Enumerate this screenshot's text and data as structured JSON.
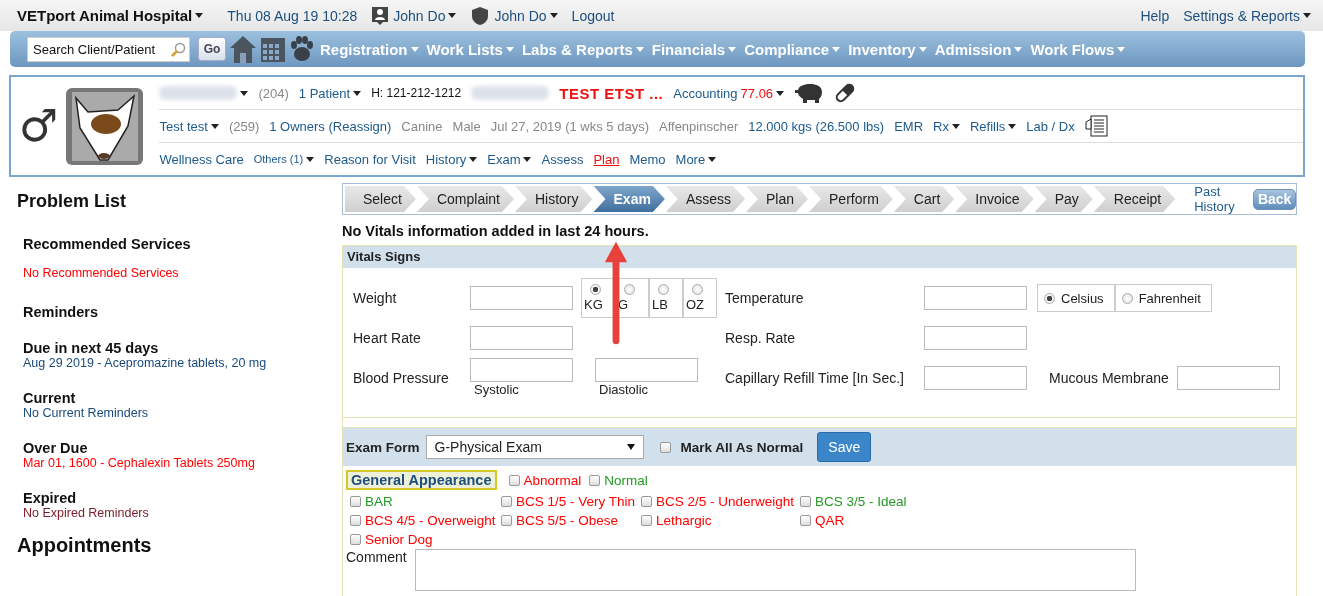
{
  "top_bar": {
    "hospital": "VETport Animal Hospital",
    "datetime": "Thu 08 Aug 19 10:28",
    "users": [
      {
        "kind": "person",
        "name": "John Do"
      },
      {
        "kind": "badge",
        "name": "John Do"
      }
    ],
    "logout": "Logout",
    "help": "Help",
    "settings": "Settings & Reports"
  },
  "nav": {
    "search_placeholder": "Search Client/Patient",
    "go": "Go",
    "menus": [
      "Registration",
      "Work Lists",
      "Labs & Reports",
      "Financials",
      "Compliance",
      "Inventory",
      "Admission",
      "Work Flows"
    ]
  },
  "patient": {
    "gender_symbol": "♂",
    "row1": [
      {
        "kind": "blurred",
        "dropdown": true
      },
      {
        "kind": "muted",
        "text": "(204)"
      },
      {
        "kind": "link",
        "text": "1  Patient",
        "dropdown": true
      },
      {
        "kind": "plain",
        "text": "H: 121-212-1212"
      },
      {
        "kind": "blurred"
      },
      {
        "kind": "alert",
        "text": "TEST ETST ..."
      },
      {
        "kind": "link",
        "text": "Accounting"
      },
      {
        "kind": "amount",
        "text": "77.06",
        "dropdown": true
      },
      {
        "kind": "piggy"
      },
      {
        "kind": "pill"
      }
    ],
    "row2": [
      {
        "kind": "link",
        "text": "Test test",
        "dropdown": true
      },
      {
        "kind": "muted",
        "text": "(259)"
      },
      {
        "kind": "link",
        "text": "1 Owners (Reassign)"
      },
      {
        "kind": "muted",
        "text": "Canine"
      },
      {
        "kind": "muted",
        "text": "Male"
      },
      {
        "kind": "muted",
        "text": "Jul 27, 2019 (1 wks 5 days)"
      },
      {
        "kind": "muted",
        "text": "Affenpinscher"
      },
      {
        "kind": "link",
        "text": "12.000 kgs (26.500 lbs)"
      },
      {
        "kind": "link",
        "text": "EMR"
      },
      {
        "kind": "link",
        "text": "Rx",
        "dropdown": true
      },
      {
        "kind": "link",
        "text": "Refills",
        "dropdown": true
      },
      {
        "kind": "link",
        "text": "Lab / Dx"
      },
      {
        "kind": "document"
      }
    ],
    "row3": [
      {
        "kind": "link",
        "text": "Wellness Care"
      },
      {
        "kind": "small",
        "text": "Others (1)",
        "dropdown": true
      },
      {
        "kind": "link",
        "text": "Reason for Visit"
      },
      {
        "kind": "link",
        "text": "History",
        "dropdown": true
      },
      {
        "kind": "link",
        "text": "Exam",
        "dropdown": true
      },
      {
        "kind": "link",
        "text": "Assess"
      },
      {
        "kind": "alert_link",
        "text": "Plan"
      },
      {
        "kind": "link",
        "text": "Memo"
      },
      {
        "kind": "link",
        "text": "More",
        "dropdown": true
      }
    ]
  },
  "sidebar": {
    "title": "Problem List",
    "sections": [
      {
        "heading": "Recommended Services",
        "kind": "spaced",
        "items": [
          {
            "text": "No Recommended Services",
            "color": "#ff0000"
          }
        ]
      },
      {
        "heading": "Reminders",
        "kind": "spaced"
      },
      {
        "heading": "Due in next 45 days",
        "kind": "tight",
        "items": [
          {
            "text": "Aug 29 2019 - Acepromazine tablets, 20 mg",
            "color": "#1a4a7a"
          }
        ]
      },
      {
        "heading": "Current",
        "kind": "tight",
        "items": [
          {
            "text": "No Current Reminders",
            "color": "#1a4a7a"
          }
        ]
      },
      {
        "heading": "Over Due",
        "kind": "tight",
        "items": [
          {
            "text": "Mar 01, 1600 - Cephalexin Tablets 250mg",
            "color": "#ff0000"
          }
        ]
      },
      {
        "heading": "Expired",
        "kind": "tight",
        "items": [
          {
            "text": "No Expired Reminders",
            "color": "#7a1a2a"
          }
        ]
      }
    ],
    "footer_title": "Appointments"
  },
  "workflow": {
    "steps": [
      {
        "label": "Select",
        "selected": false
      },
      {
        "label": "Complaint",
        "selected": false
      },
      {
        "label": "History",
        "selected": false
      },
      {
        "label": "Exam",
        "selected": true
      },
      {
        "label": "Assess",
        "selected": false
      },
      {
        "label": "Plan",
        "selected": false
      },
      {
        "label": "Perform",
        "selected": false
      },
      {
        "label": "Cart",
        "selected": false
      },
      {
        "label": "Invoice",
        "selected": false
      },
      {
        "label": "Pay",
        "selected": false
      },
      {
        "label": "Receipt",
        "selected": false
      }
    ],
    "past_history": "Past History",
    "back": "Back"
  },
  "notice": "No Vitals information added in last 24 hours.",
  "vitals": {
    "title": "Vitals Signs",
    "weight": {
      "label": "Weight",
      "units": [
        {
          "label": "KG",
          "selected": true
        },
        {
          "label": "G",
          "selected": false
        },
        {
          "label": "LB",
          "selected": false
        },
        {
          "label": "OZ",
          "selected": false
        }
      ]
    },
    "temperature": {
      "label": "Temperature",
      "units": [
        {
          "label": "Celsius",
          "selected": true
        },
        {
          "label": "Fahrenheit",
          "selected": false
        }
      ]
    },
    "heart_rate": "Heart Rate",
    "resp_rate": "Resp. Rate",
    "blood_pressure": {
      "label": "Blood Pressure",
      "systolic": "Systolic",
      "diastolic": "Diastolic"
    },
    "capillary": "Capillary Refill Time [In Sec.]",
    "mucous": "Mucous Membrane"
  },
  "exam_form": {
    "label": "Exam Form",
    "value": "G-Physical Exam",
    "mark_all": {
      "label": "Mark All As Normal",
      "checked": false
    },
    "save": "Save"
  },
  "general": {
    "title": "General Appearance",
    "flags": [
      {
        "label": "Abnormal",
        "checked": false,
        "color": "#ff0000"
      },
      {
        "label": "Normal",
        "checked": false,
        "color": "#229922"
      }
    ],
    "options": [
      {
        "label": "BAR",
        "checked": false,
        "color": "#229922"
      },
      {
        "label": "BCS 1/5 - Very Thin",
        "checked": false,
        "color": "#ff0000"
      },
      {
        "label": "BCS 2/5 - Underweight",
        "checked": false,
        "color": "#ff0000"
      },
      {
        "label": "BCS 3/5 - Ideal",
        "checked": false,
        "color": "#229922"
      },
      {
        "label": "BCS 4/5 - Overweight",
        "checked": false,
        "color": "#ff0000"
      },
      {
        "label": "BCS 5/5 - Obese",
        "checked": false,
        "color": "#ff0000"
      },
      {
        "label": "Lethargic",
        "checked": false,
        "color": "#ff0000"
      },
      {
        "label": "QAR",
        "checked": false,
        "color": "#ff0000"
      },
      {
        "label": "Senior Dog",
        "checked": false,
        "color": "#ff0000"
      }
    ],
    "comment_label": "Comment"
  }
}
